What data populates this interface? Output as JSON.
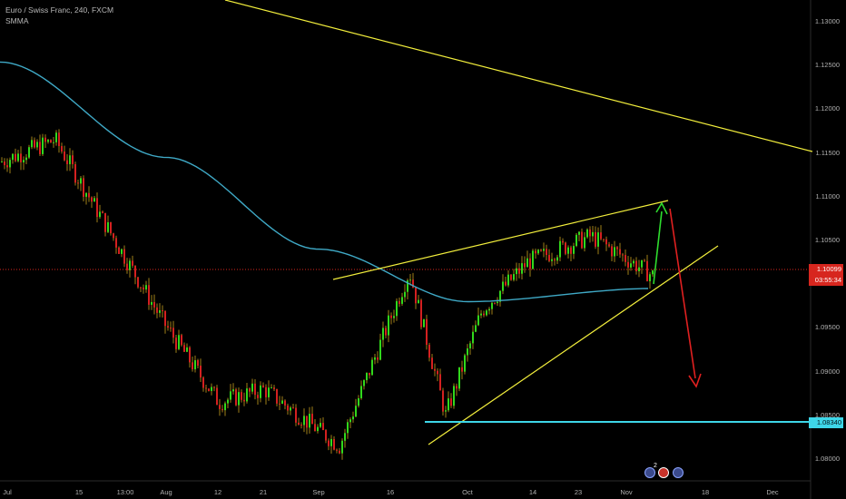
{
  "legend": {
    "title": "Euro / Swiss Franc, 240, FXCM",
    "indicator": "SMMA"
  },
  "price_tags": {
    "current": "1.10099",
    "countdown": "03:55:34",
    "support": "1.08340"
  },
  "price_scale": [
    {
      "label": "1.13000",
      "value": 1.13
    },
    {
      "label": "1.12500",
      "value": 1.125
    },
    {
      "label": "1.12000",
      "value": 1.12
    },
    {
      "label": "1.11500",
      "value": 1.115
    },
    {
      "label": "1.11000",
      "value": 1.11
    },
    {
      "label": "1.10500",
      "value": 1.105
    },
    {
      "label": "1.09500",
      "value": 1.095
    },
    {
      "label": "1.09000",
      "value": 1.09
    },
    {
      "label": "1.08500",
      "value": 1.085
    },
    {
      "label": "1.08000",
      "value": 1.08
    }
  ],
  "time_scale": [
    "Jul",
    "15",
    "13:00",
    "Aug",
    "12",
    "21",
    "Sep",
    "16",
    "Oct",
    "14",
    "23",
    "Nov",
    "18",
    "Dec"
  ],
  "events": {
    "count": "2"
  },
  "colors": {
    "background": "#000000",
    "candle_up": "#31d81c",
    "candle_down": "#d42020",
    "candle_wick": "#c8a020",
    "smma": "#3fa9c6",
    "trendline": "#f2ee3c",
    "support_line": "#3ed6e8",
    "current_price": "#d7261e",
    "arrow_up": "#2edc2e",
    "arrow_down": "#e02020"
  },
  "chart_data": {
    "type": "candlestick",
    "symbol": "Euro / Swiss Franc",
    "interval": "240",
    "ylim": [
      1.0775,
      1.1325
    ],
    "x_range": [
      "Jul",
      "Dec"
    ],
    "key_points": [
      {
        "x": "Jul",
        "y": 1.114
      },
      {
        "x": "mid-Jul",
        "y": 1.1165
      },
      {
        "x": "Aug",
        "y": 1.0955
      },
      {
        "x": "Aug 12",
        "y": 1.0865
      },
      {
        "x": "Aug 21",
        "y": 1.088
      },
      {
        "x": "Sep",
        "y": 1.0815
      },
      {
        "x": "Sep 16",
        "y": 1.1015
      },
      {
        "x": "Sep 26",
        "y": 1.085
      },
      {
        "x": "Oct",
        "y": 1.097
      },
      {
        "x": "Oct 10",
        "y": 1.1025
      },
      {
        "x": "Oct 23",
        "y": 1.1055
      },
      {
        "x": "Nov",
        "y": 1.101
      }
    ],
    "smma": [
      {
        "x": "Jul",
        "y": 1.1254
      },
      {
        "x": "Aug",
        "y": 1.1145
      },
      {
        "x": "Sep",
        "y": 1.104
      },
      {
        "x": "Oct",
        "y": 1.098
      },
      {
        "x": "Nov",
        "y": 1.0995
      }
    ],
    "annotations": [
      {
        "type": "trendline",
        "from": {
          "x": "Jul",
          "y": 1.134
        },
        "to": {
          "x": "Dec",
          "y": 1.1145
        }
      },
      {
        "type": "trendline",
        "from": {
          "x": "Sep",
          "y": 1.1
        },
        "to": {
          "x": "Nov",
          "y": 1.1085
        }
      },
      {
        "type": "trendline",
        "from": {
          "x": "Sep",
          "y": 1.082
        },
        "to": {
          "x": "Nov",
          "y": 1.1035
        }
      },
      {
        "type": "horizontal",
        "y": 1.0834
      },
      {
        "type": "arrow-up",
        "from": {
          "x": "Nov",
          "y": 1.1005
        },
        "to": {
          "x": "Nov",
          "y": 1.1085
        }
      },
      {
        "type": "arrow-down",
        "from": {
          "x": "Nov",
          "y": 1.1085
        },
        "to": {
          "x": "Nov",
          "y": 1.0875
        }
      }
    ]
  }
}
